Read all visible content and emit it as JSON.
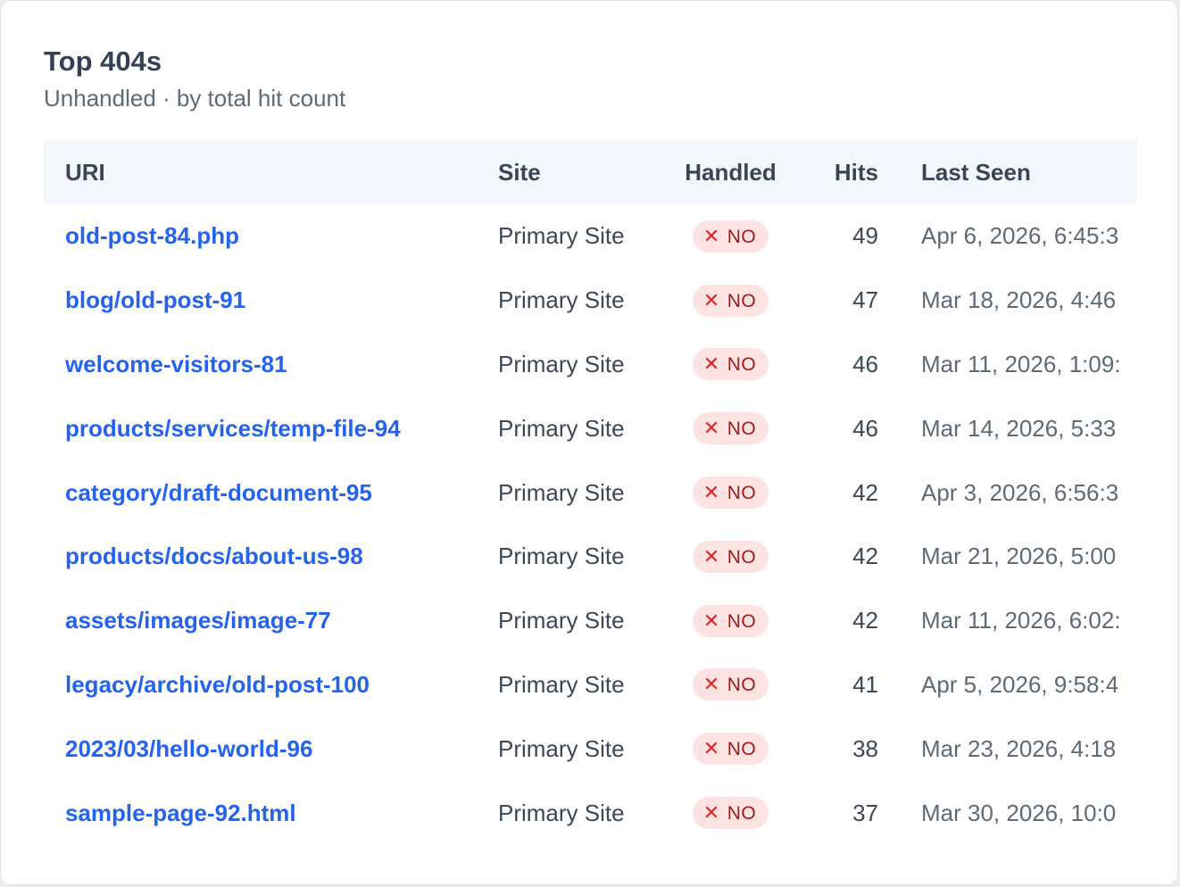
{
  "card": {
    "title": "Top 404s",
    "subtitle": "Unhandled · by total hit count"
  },
  "table": {
    "columns": [
      "URI",
      "Site",
      "Handled",
      "Hits",
      "Last Seen"
    ],
    "rows": [
      {
        "uri": "old-post-84.php",
        "site": "Primary Site",
        "handled": "NO",
        "hits": "49",
        "last_seen": "Apr 6, 2026, 6:45:3"
      },
      {
        "uri": "blog/old-post-91",
        "site": "Primary Site",
        "handled": "NO",
        "hits": "47",
        "last_seen": "Mar 18, 2026, 4:46"
      },
      {
        "uri": "welcome-visitors-81",
        "site": "Primary Site",
        "handled": "NO",
        "hits": "46",
        "last_seen": "Mar 11, 2026, 1:09:"
      },
      {
        "uri": "products/services/temp-file-94",
        "site": "Primary Site",
        "handled": "NO",
        "hits": "46",
        "last_seen": "Mar 14, 2026, 5:33"
      },
      {
        "uri": "category/draft-document-95",
        "site": "Primary Site",
        "handled": "NO",
        "hits": "42",
        "last_seen": "Apr 3, 2026, 6:56:3"
      },
      {
        "uri": "products/docs/about-us-98",
        "site": "Primary Site",
        "handled": "NO",
        "hits": "42",
        "last_seen": "Mar 21, 2026, 5:00"
      },
      {
        "uri": "assets/images/image-77",
        "site": "Primary Site",
        "handled": "NO",
        "hits": "42",
        "last_seen": "Mar 11, 2026, 6:02:"
      },
      {
        "uri": "legacy/archive/old-post-100",
        "site": "Primary Site",
        "handled": "NO",
        "hits": "41",
        "last_seen": "Apr 5, 2026, 9:58:4"
      },
      {
        "uri": "2023/03/hello-world-96",
        "site": "Primary Site",
        "handled": "NO",
        "hits": "38",
        "last_seen": "Mar 23, 2026, 4:18"
      },
      {
        "uri": "sample-page-92.html",
        "site": "Primary Site",
        "handled": "NO",
        "hits": "37",
        "last_seen": "Mar 30, 2026, 10:0"
      }
    ]
  },
  "icons": {
    "not_handled": "close-x-icon"
  },
  "colors": {
    "link": "#2563eb",
    "badge_bg": "#fde2e2",
    "badge_text": "#9b1c1c",
    "badge_icon": "#dc2626",
    "header_bg": "#f3f6fa"
  }
}
